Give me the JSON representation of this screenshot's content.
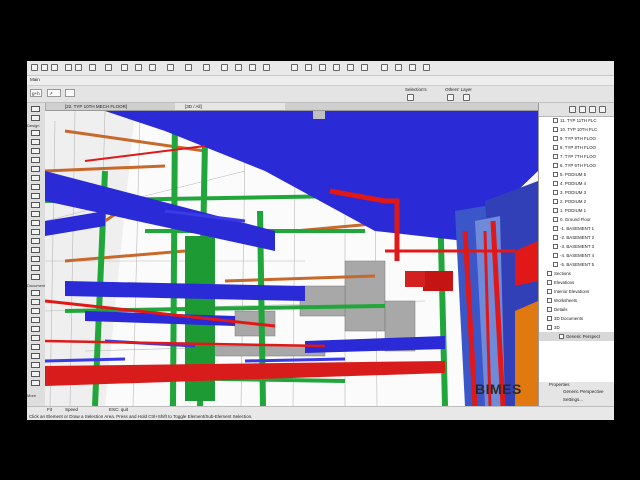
{
  "infobar": {
    "label": "Main"
  },
  "infobox": {
    "floor_field": "g+h",
    "arrow_field": "↗",
    "selection_label": "Selection's",
    "others_layer_label": "Others' Layer"
  },
  "toolbox": {
    "design_header": "Design",
    "document_header": "Document",
    "more_label": "More"
  },
  "tabs": [
    {
      "label": "[22. TYP 10TH MECH FLOOR]"
    },
    {
      "label": "[3D / All]"
    }
  ],
  "navigator": {
    "items": [
      {
        "label": "11. TYP 11TH FLC"
      },
      {
        "label": "10. TYP 10TH FLC"
      },
      {
        "label": "9. TYP 9TH FLOO"
      },
      {
        "label": "8. TYP 8TH FLOO"
      },
      {
        "label": "7. TYP 7TH FLOO"
      },
      {
        "label": "6. TYP 6TH FLOO"
      },
      {
        "label": "5. PODIUM 5"
      },
      {
        "label": "4. PODIUM 4"
      },
      {
        "label": "3. PODIUM 3"
      },
      {
        "label": "2. PODIUM 2"
      },
      {
        "label": "1. PODIUM 1"
      },
      {
        "label": "0. Ground Floor"
      },
      {
        "label": "-1. BASEMENT 1"
      },
      {
        "label": "-2. BASEMENT 2"
      },
      {
        "label": "-3. BASEMENT 3"
      },
      {
        "label": "-4. BASEMENT 4"
      },
      {
        "label": "-5. BASEMENT 5"
      },
      {
        "label": "Sections"
      },
      {
        "label": "Elevations"
      },
      {
        "label": "Interior Elevations"
      },
      {
        "label": "Worksheets"
      },
      {
        "label": "Details"
      },
      {
        "label": "3D Documents"
      },
      {
        "label": "3D"
      },
      {
        "label": "Generic Perspect"
      }
    ]
  },
  "properties": {
    "header": "Properties",
    "view_name": "Generic Perspective",
    "settings_button": "Settings..."
  },
  "status": {
    "zoom": "Fit",
    "speed": "Speed",
    "esc": "ESC: quit",
    "hint": "Click an Element or Draw a Selection Area. Press and Hold Ctrl+Shift to Toggle Element/Sub-Element Selection."
  },
  "watermark": "BIMES",
  "colors": {
    "duct_blue": "#2e2ed6",
    "pipe_red": "#e01818",
    "pipe_green": "#22a83a",
    "pipe_orange": "#c86a1e",
    "steel_gray": "#9a9a9a"
  }
}
